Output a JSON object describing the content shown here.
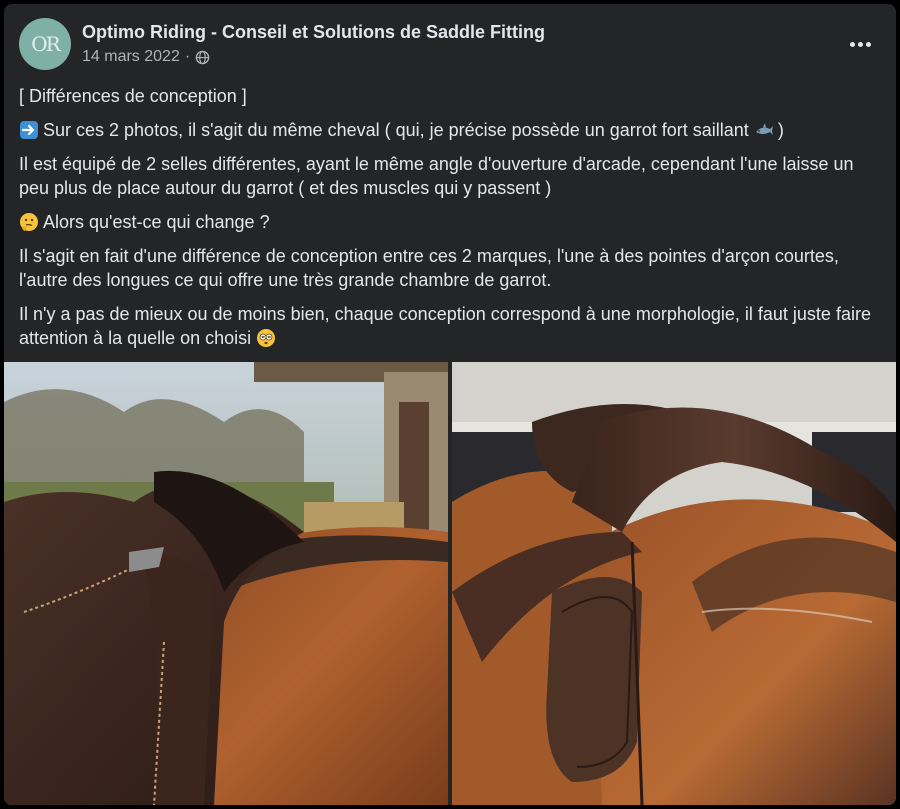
{
  "post": {
    "page_name": "Optimo Riding - Conseil et Solutions de Saddle Fitting",
    "avatar_text": "OR",
    "date": "14 mars 2022",
    "separator": "·",
    "privacy_icon": "globe-icon",
    "more_icon": "more-horizontal-icon",
    "paragraphs": {
      "p1": "[ Différences de conception ]",
      "p2": "Sur ces 2 photos, il s'agit du même cheval ( qui, je précise possède un garrot fort saillant",
      "p2_end": ")",
      "p3": "Il est équipé de 2 selles différentes, ayant le même angle d'ouverture d'arcade, cependant l'une laisse un peu plus de place autour du garrot ( et des muscles qui y passent )",
      "p4": "Alors qu'est-ce qui change ?",
      "p5": "Il s'agit en fait d'une différence de conception entre ces 2 marques, l'une à des pointes d'arçon courtes, l'autre des longues ce qui offre une très grande chambre de garrot.",
      "p6": "Il n'y a pas de mieux ou de moins bien, chaque conception correspond à une morphologie, il faut juste faire attention à la quelle on choisi"
    },
    "emojis": [
      "arrow-right-emoji",
      "shark-emoji",
      "thinking-face-emoji",
      "dizzy-face-emoji"
    ],
    "photos": [
      "saddle-photo-short-points",
      "saddle-photo-long-points"
    ]
  },
  "colors": {
    "background": "#242526",
    "text": "#e4e6eb",
    "secondary_text": "#b0b3b8",
    "avatar": "#7fb0a6"
  }
}
